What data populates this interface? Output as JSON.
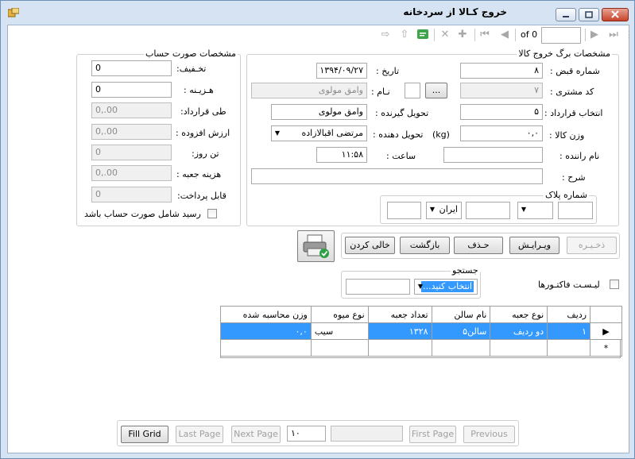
{
  "window": {
    "title": "خروج کـالا از سردخانه"
  },
  "navigator": {
    "of_label": "of 0",
    "position_value": ""
  },
  "receipt_group": {
    "legend": "مشخصات برگ خروج کالا",
    "receipt_no_label": "شماره قبض :",
    "receipt_no_value": "۸",
    "date_label": "تاریخ :",
    "date_value": "۱۳۹۴/۰۹/۲۷",
    "customer_code_label": "کد مشتری :",
    "customer_code_value": "۷",
    "name_label": "نـام :",
    "name_value": "وامق مولوی",
    "browse_label": "...",
    "contract_label": "انتخاب  قرارداد :",
    "contract_value": "۵",
    "receiver_label": "تحویل گیرنده :",
    "receiver_value": "وامق مولوی",
    "weight_label": "وزن کالا  :",
    "weight_value": "۰,۰",
    "kg_label": "(kg)",
    "deliverer_label": "تحویل دهنده :",
    "deliverer_value": "مرتضی  اقبالازاده",
    "driver_label": "نام راننده :",
    "driver_value": "",
    "time_label": "ساعت :",
    "time_value": "۱۱:۵۸",
    "desc_label": "شرح :",
    "desc_value": "",
    "plate_legend": "شماره پلاک",
    "plate_country": "ایران"
  },
  "account_group": {
    "legend": "مشخصات صورت حساب",
    "discount_label": "تخـفیف:",
    "discount_value": "0",
    "cost_label": "هـزیـنه :",
    "cost_value": "0",
    "contract_label": "طی قرارداد:",
    "contract_value": "0,.00",
    "vat_label": "ارزش افزوده :",
    "vat_value": "0,.00",
    "ton_day_label": "تن روز:",
    "ton_day_value": "0",
    "box_cost_label": "هزینه جعبه :",
    "box_cost_value": "0,.00",
    "payable_label": "قابل پرداخت:",
    "payable_value": "0",
    "include_label": "رسید شامل صورت حساب باشد"
  },
  "actions": {
    "save": "ذخـیـره",
    "edit": "ویـرایـش",
    "delete": "حـذف",
    "back": "بازگشت",
    "clear": "خالی کردن"
  },
  "search": {
    "legend": "جستجو",
    "combo_value": "انتخاب کنید...",
    "invoice_list_label": "لیـسـت فاکتـورها"
  },
  "grid": {
    "columns": [
      "ردیف",
      "نوع جعبه",
      "نام سالن",
      "تعداد جعبه",
      "نوع میوه",
      "وزن محاسبه شده"
    ],
    "rows": [
      [
        "۱",
        "دو ردیف",
        "سالن۵",
        "۱۳۲۸",
        "سیب",
        "۰,۰"
      ]
    ],
    "new_row_marker": "*"
  },
  "pager": {
    "fill_grid": "Fill Grid",
    "last_page": "Last Page",
    "next_page": "Next Page",
    "page_size": "۱۰",
    "page_info": "",
    "first_page": "First Page",
    "previous": "Previous"
  },
  "colors": {
    "selection": "#3399ff",
    "window_frame": "#d6e3f2",
    "close_button": "#c7432b"
  }
}
